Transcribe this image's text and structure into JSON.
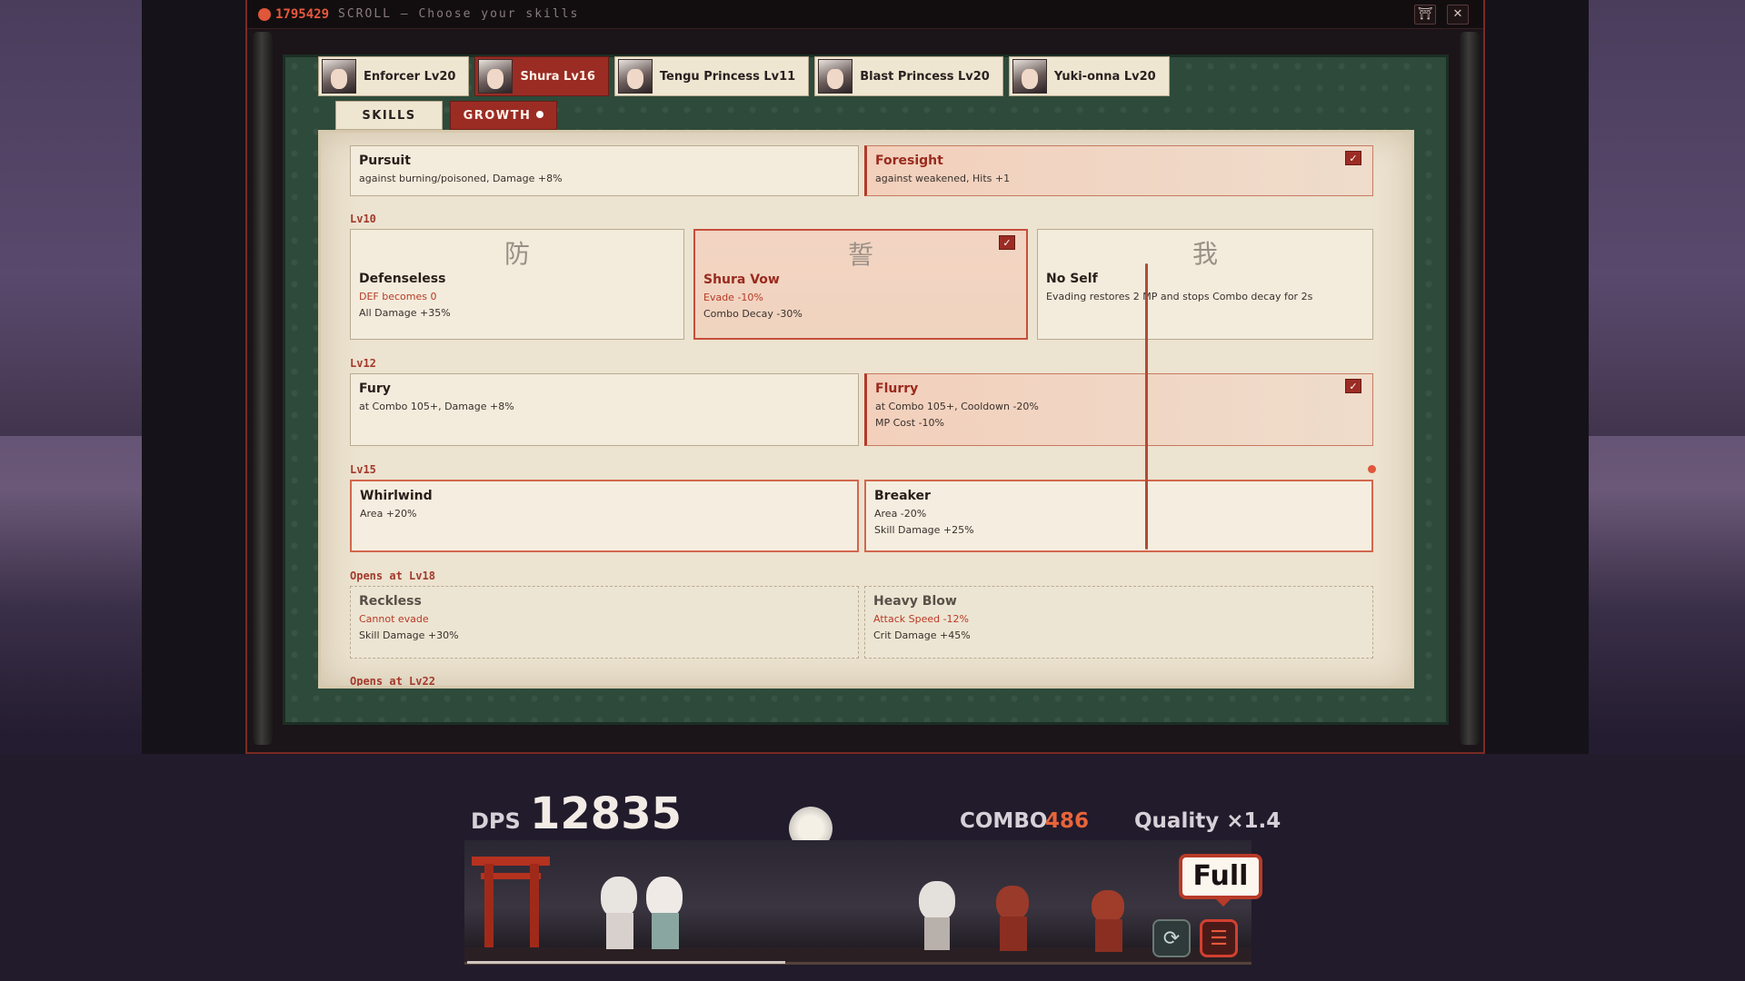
{
  "titlebar": {
    "coins": "1795429",
    "title": "SCROLL — Choose your skills",
    "home_icon": "shrine-icon",
    "close_label": "✕"
  },
  "characters": [
    {
      "label": "Enforcer Lv20",
      "active": false
    },
    {
      "label": "Shura Lv16",
      "active": true
    },
    {
      "label": "Tengu Princess Lv11",
      "active": false
    },
    {
      "label": "Blast Princess Lv20",
      "active": false
    },
    {
      "label": "Yuki-onna Lv20",
      "active": false
    }
  ],
  "subtabs": {
    "skills": "SKILLS",
    "growth": "GROWTH"
  },
  "skill_tree": {
    "row_top": {
      "left": {
        "name": "Pursuit",
        "d1": "against burning/poisoned, Damage +8%"
      },
      "right": {
        "name": "Foresight",
        "d1": "against weakened, Hits +1",
        "selected": true
      }
    },
    "lv10": {
      "label": "Lv10",
      "cards": [
        {
          "kanji": "防",
          "name": "Defenseless",
          "d1": "DEF becomes 0",
          "d2": "All Damage +35%"
        },
        {
          "kanji": "誓",
          "name": "Shura Vow",
          "d1": "Evade -10%",
          "d2": "Combo Decay -30%",
          "selected": true
        },
        {
          "kanji": "我",
          "name": "No Self",
          "d1": "Evading restores 2 MP and stops Combo decay for 2s"
        }
      ]
    },
    "lv12": {
      "label": "Lv12",
      "left": {
        "name": "Fury",
        "d1": "at Combo 105+, Damage +8%"
      },
      "right": {
        "name": "Flurry",
        "d1": "at Combo 105+, Cooldown -20%",
        "d2": "MP Cost -10%",
        "selected": true
      }
    },
    "lv15": {
      "label": "Lv15",
      "left": {
        "name": "Whirlwind",
        "d1": "Area +20%"
      },
      "right": {
        "name": "Breaker",
        "d1": "Area -20%",
        "d2": "Skill Damage +25%"
      }
    },
    "lv18": {
      "label": "Opens at Lv18",
      "left": {
        "name": "Reckless",
        "d1": "Cannot evade",
        "d2": "Skill Damage +30%"
      },
      "right": {
        "name": "Heavy Blow",
        "d1": "Attack Speed -12%",
        "d2": "Crit Damage +45%"
      }
    },
    "lv22_label": "Opens at Lv22"
  },
  "hud": {
    "dps_label": "DPS",
    "dps_value": "12835",
    "combo_label": "COMBO",
    "combo_value": "486",
    "quality": "Quality ×1.4",
    "full_label": "Full"
  },
  "colors": {
    "accent": "#9b2c24",
    "paper": "#ece3d0",
    "mat": "#2e4a3a"
  }
}
